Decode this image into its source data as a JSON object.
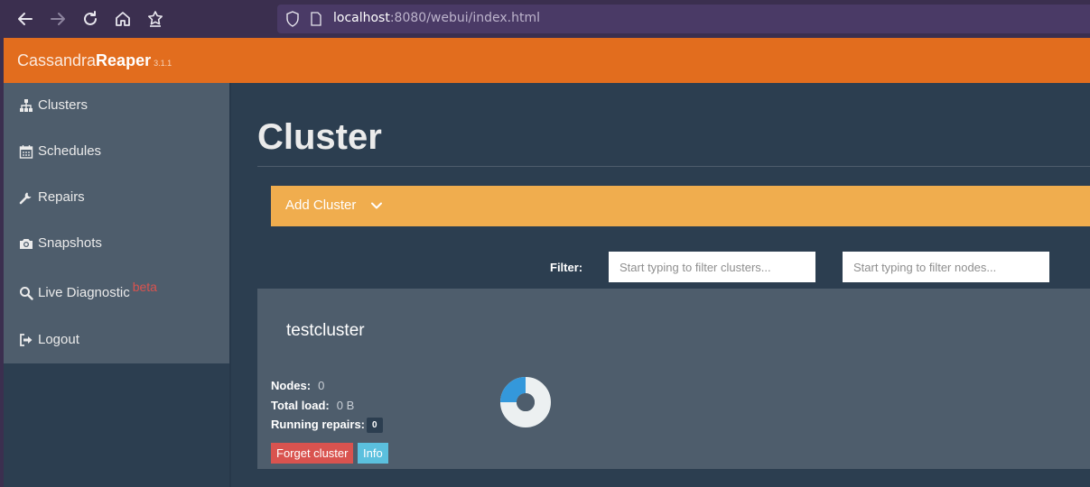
{
  "browser": {
    "url_host": "localhost",
    "url_rest": ":8080/webui/index.html",
    "back_icon": "arrow-left-icon",
    "forward_icon": "arrow-right-icon",
    "reload_icon": "reload-icon",
    "home_icon": "home-icon",
    "extension_icon": "extension-icon"
  },
  "header": {
    "brand_light": "Cassandra",
    "brand_bold": "Reaper",
    "version": "3.1.1",
    "color": "#e26d1e"
  },
  "sidebar": {
    "items": [
      {
        "label": "Clusters",
        "icon": "sitemap-icon"
      },
      {
        "label": "Schedules",
        "icon": "calendar-icon"
      },
      {
        "label": "Repairs",
        "icon": "wrench-icon"
      },
      {
        "label": "Snapshots",
        "icon": "camera-icon"
      },
      {
        "label": "Live Diagnostic",
        "icon": "search-icon",
        "badge": "beta"
      },
      {
        "label": "Logout",
        "icon": "sign-out-icon"
      }
    ]
  },
  "main": {
    "title": "Cluster",
    "add_cluster_label": "Add Cluster",
    "filter": {
      "label": "Filter:",
      "clusters_placeholder": "Start typing to filter clusters...",
      "nodes_placeholder": "Start typing to filter nodes..."
    },
    "cluster": {
      "name": "testcluster",
      "nodes_label": "Nodes:",
      "nodes_value": "0",
      "load_label": "Total load:",
      "load_value": "0 B",
      "repairs_label": "Running repairs:",
      "repairs_value": "0",
      "forget_label": "Forget cluster",
      "info_label": "Info",
      "donut_fraction": 0.25
    }
  }
}
